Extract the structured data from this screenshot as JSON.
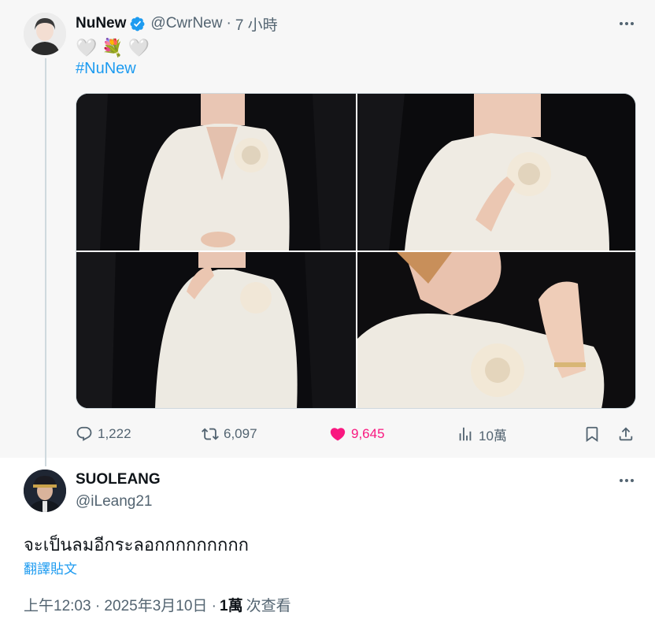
{
  "colors": {
    "accent": "#1d9bf0",
    "like": "#f91880",
    "muted": "#536471",
    "text": "#0f1419",
    "thread_line": "#cfd9de"
  },
  "original_tweet": {
    "display_name": "NuNew",
    "verified_icon": "verified-badge-icon",
    "handle": "@CwrNew",
    "separator": "·",
    "time_ago": "7 小時",
    "emoji_text": [
      "🤍",
      "💐",
      "🤍"
    ],
    "hashtag": "#NuNew",
    "photos": [
      {
        "name": "photo-1"
      },
      {
        "name": "photo-2"
      },
      {
        "name": "photo-3"
      },
      {
        "name": "photo-4"
      }
    ],
    "actions": {
      "replies": "1,222",
      "retweets": "6,097",
      "likes": "9,645",
      "views": "10萬"
    }
  },
  "reply_tweet": {
    "display_name": "SUOLEANG",
    "handle": "@iLeang21",
    "text": "จะเป็นลมอีกระลอกกกกกกกกก",
    "translate_label": "翻譯貼文",
    "timestamp": "上午12:03 · 2025年3月10日 ·",
    "views_count": "1萬",
    "views_label": "次查看"
  }
}
